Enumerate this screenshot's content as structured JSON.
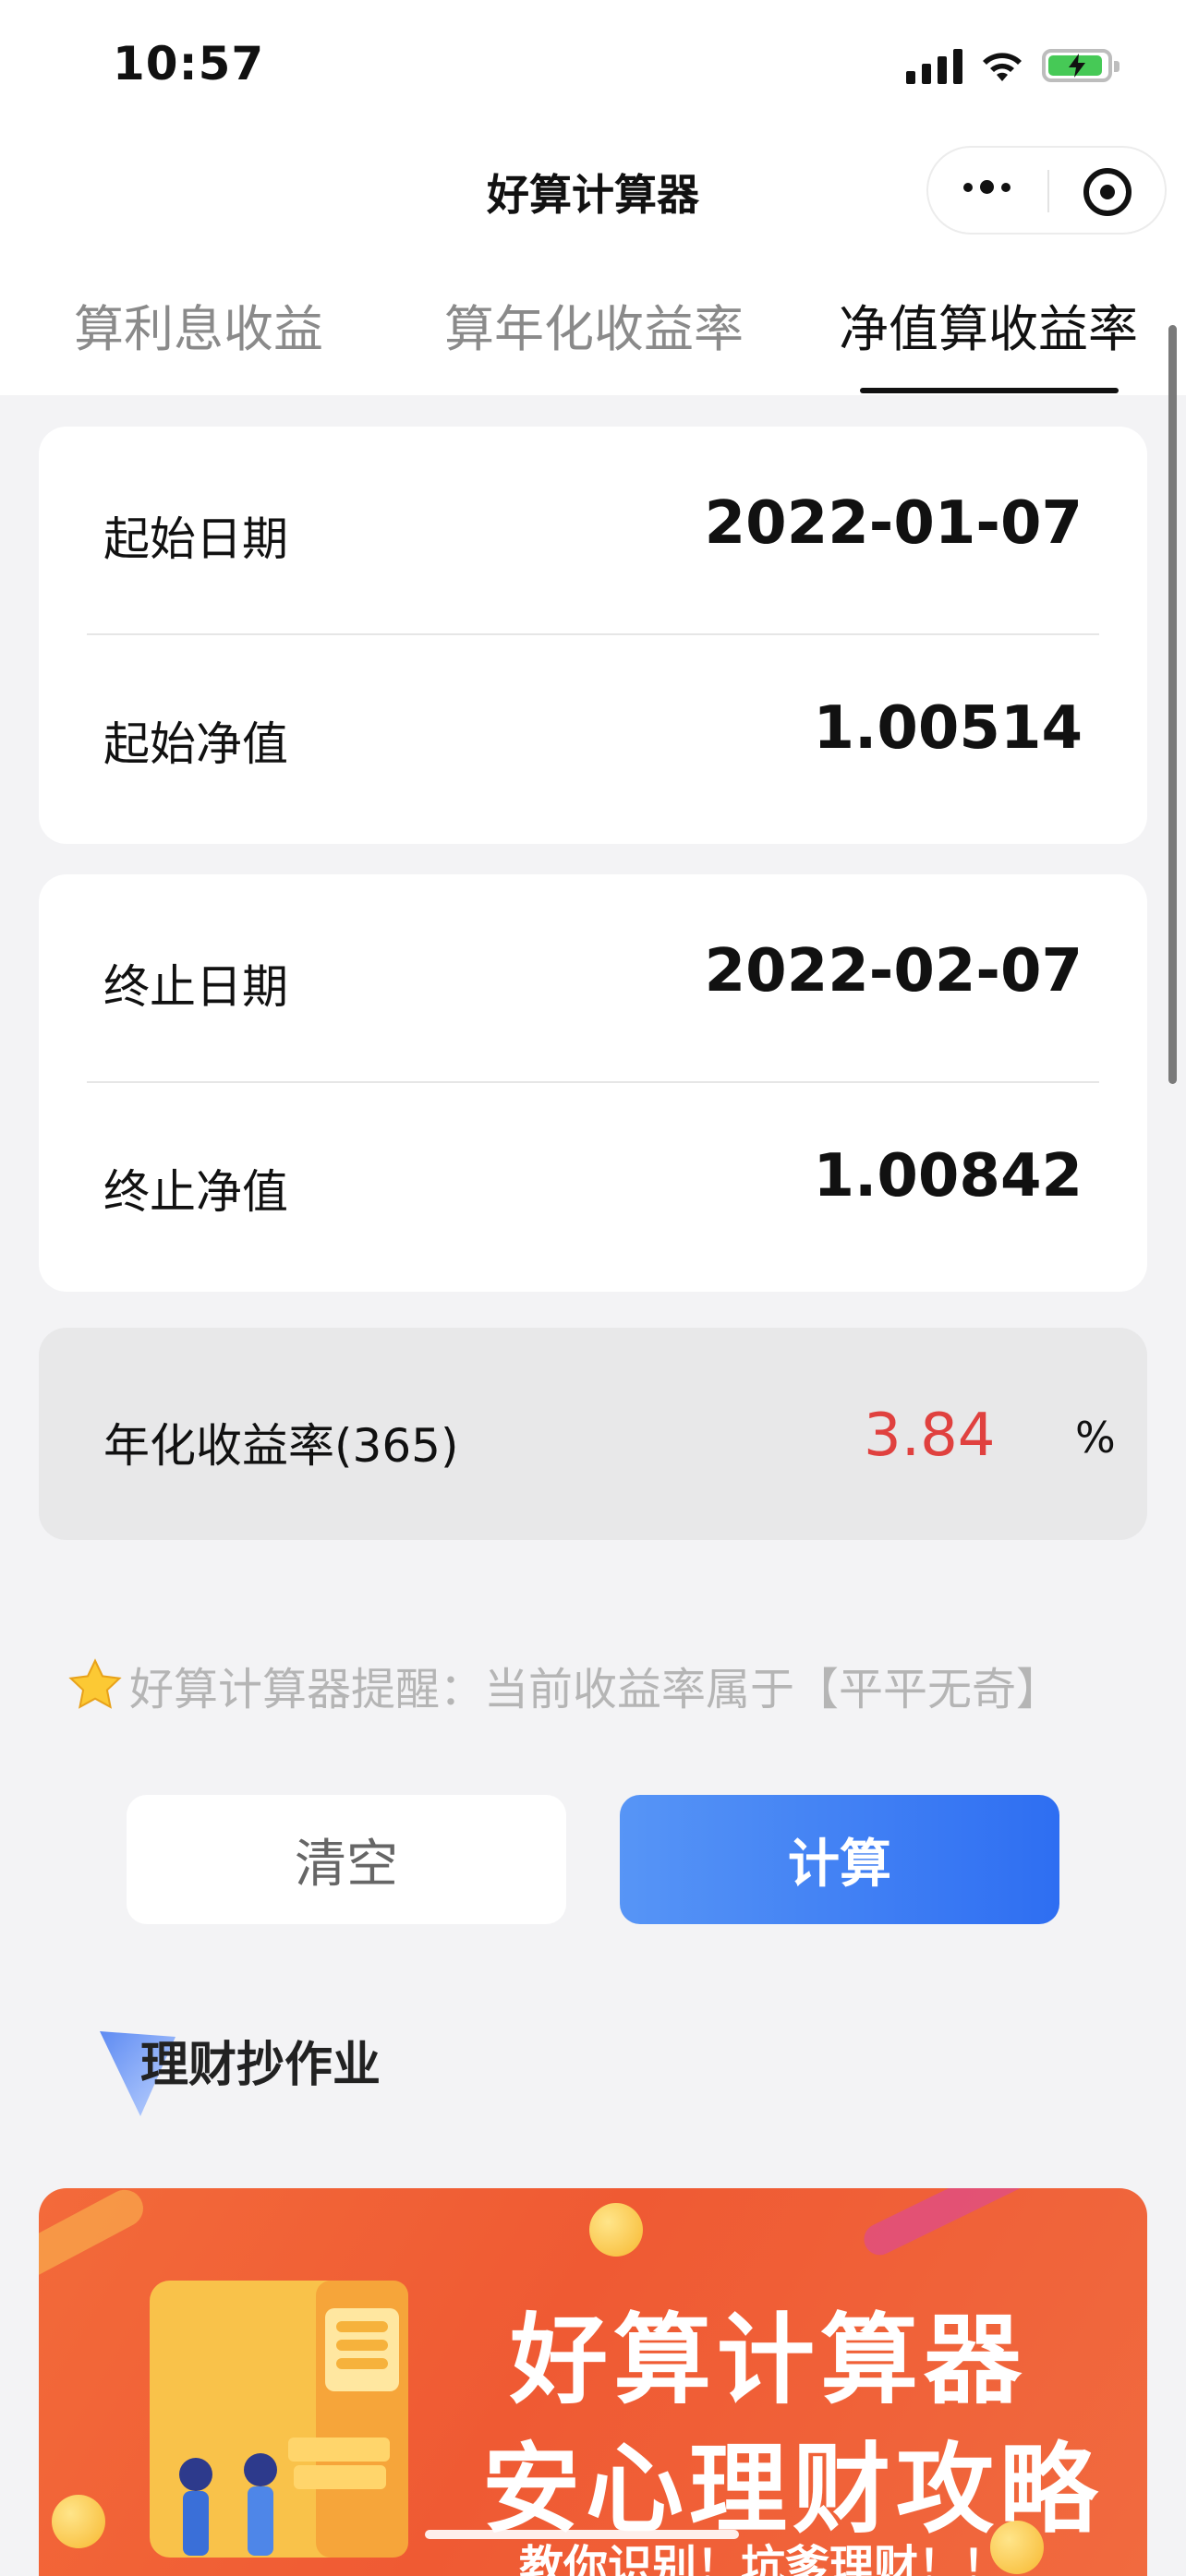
{
  "status_bar": {
    "time": "10:57"
  },
  "nav": {
    "title": "好算计算器"
  },
  "tabs": [
    {
      "label": "算利息收益",
      "active": false
    },
    {
      "label": "算年化收益率",
      "active": false
    },
    {
      "label": "净值算收益率",
      "active": true
    }
  ],
  "start_card": {
    "date_label": "起始日期",
    "date_value": "2022-01-07",
    "nav_label": "起始净值",
    "nav_value": "1.00514"
  },
  "end_card": {
    "date_label": "终止日期",
    "date_value": "2022-02-07",
    "nav_label": "终止净值",
    "nav_value": "1.00842"
  },
  "result": {
    "label": "年化收益率(365)",
    "value": "3.84",
    "unit": "%",
    "value_color": "#e0413f"
  },
  "reminder": {
    "text": "好算计算器提醒：当前收益率属于【平平无奇】"
  },
  "buttons": {
    "clear_label": "清空",
    "calc_label": "计算",
    "calc_color": "#3d7cf4"
  },
  "section": {
    "title": "理财抄作业"
  },
  "banner": {
    "line1": "好算计算器",
    "line2": "安心理财攻略",
    "line3": "教你识别！坑爹理财！！"
  }
}
